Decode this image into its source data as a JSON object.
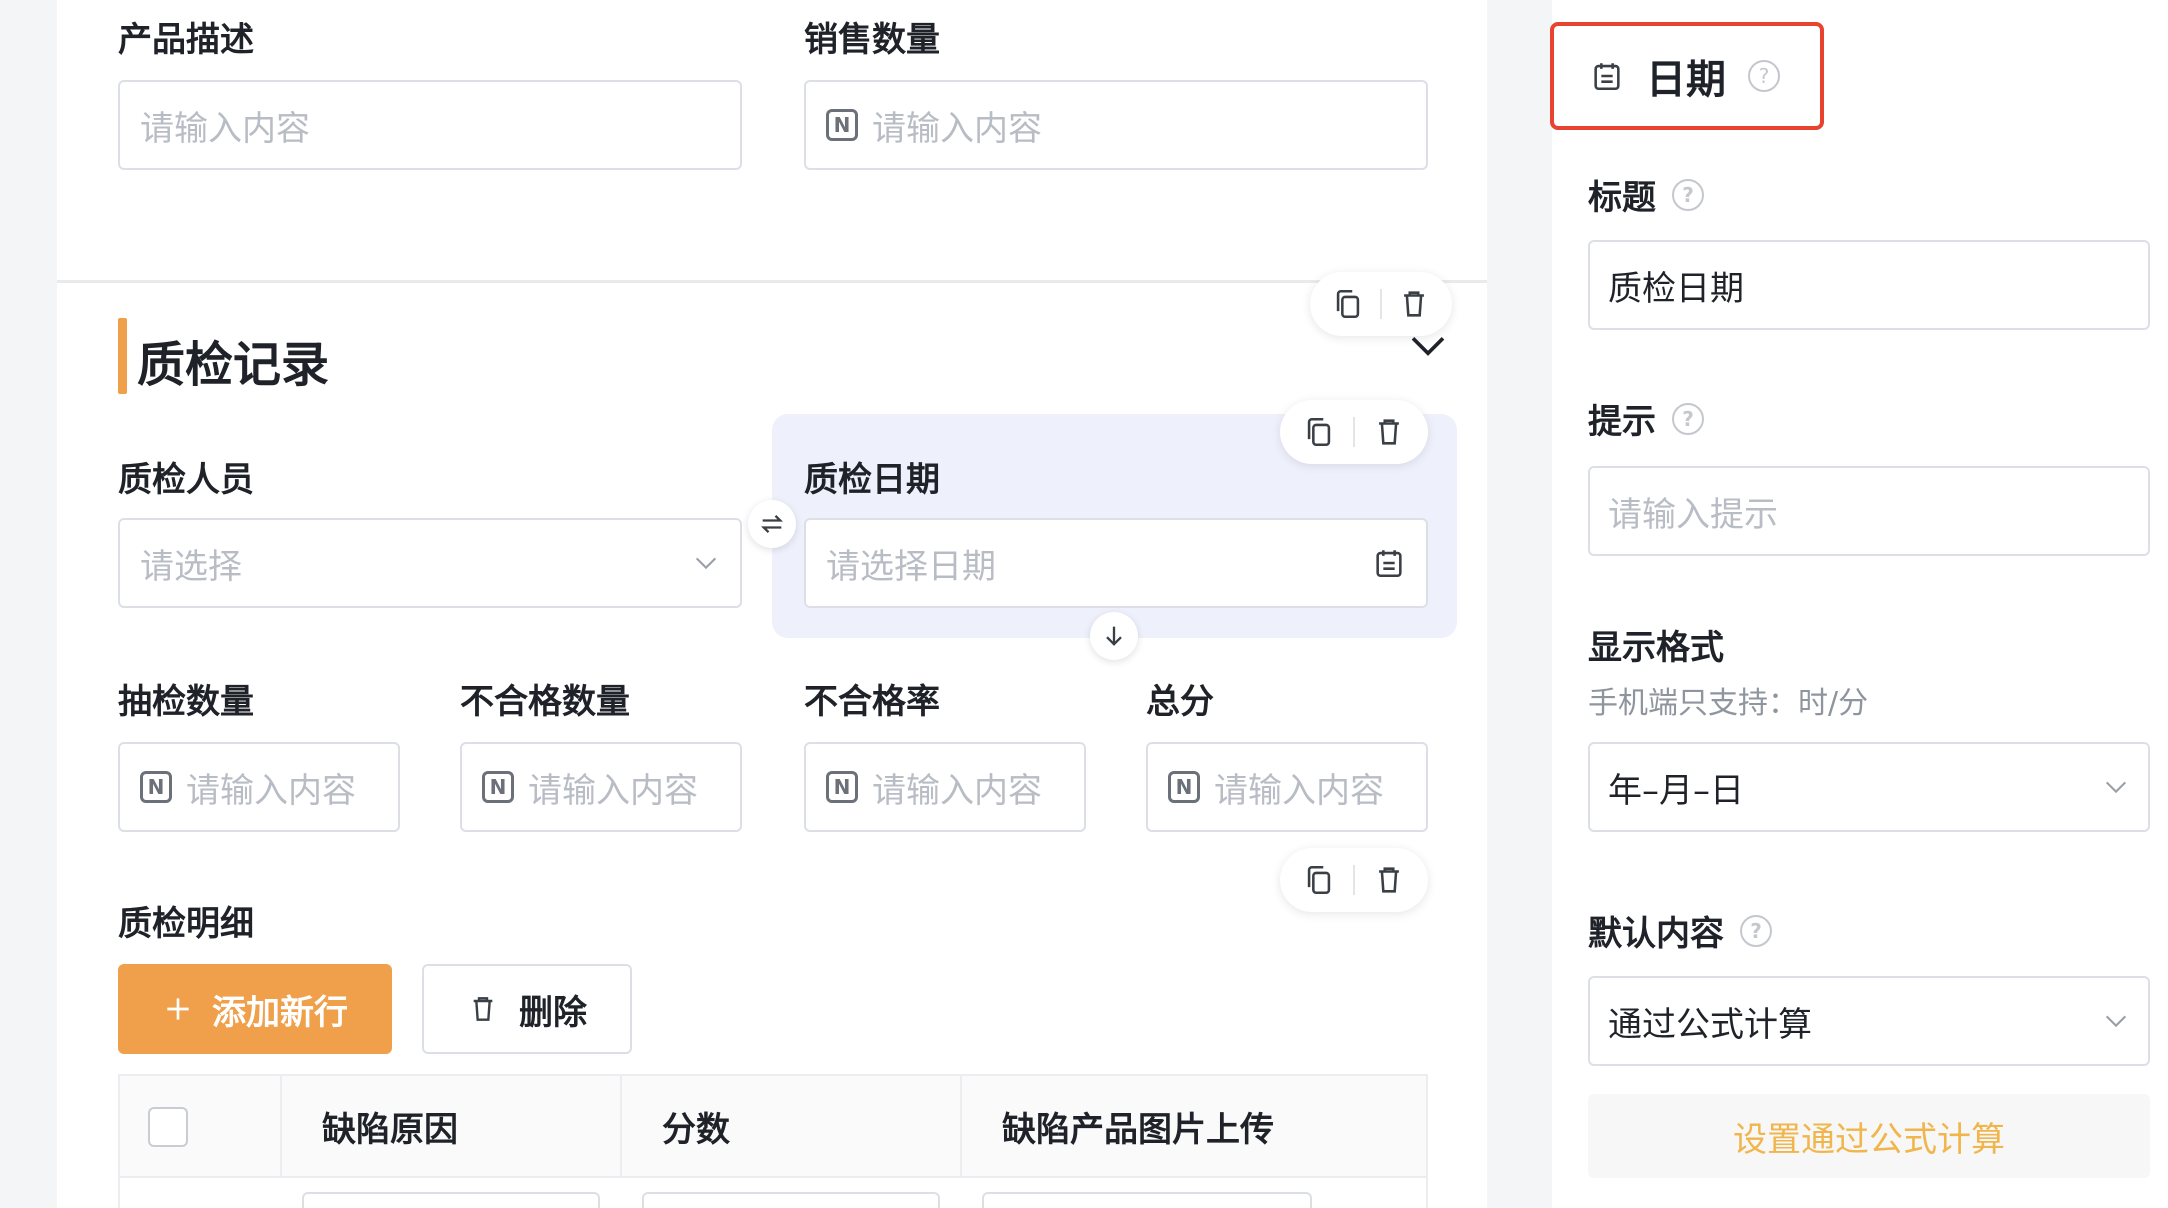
{
  "form": {
    "fields_top": {
      "product_desc": {
        "label": "产品描述",
        "placeholder": "请输入内容"
      },
      "sales_qty": {
        "label": "销售数量",
        "placeholder": "请输入内容"
      }
    },
    "section": {
      "title": "质检记录"
    },
    "inspector": {
      "label": "质检人员",
      "placeholder": "请选择"
    },
    "inspect_date": {
      "label": "质检日期",
      "placeholder": "请选择日期"
    },
    "sample_qty": {
      "label": "抽检数量",
      "placeholder": "请输入内容"
    },
    "defect_qty": {
      "label": "不合格数量",
      "placeholder": "请输入内容"
    },
    "defect_rate": {
      "label": "不合格率",
      "placeholder": "请输入内容"
    },
    "total_score": {
      "label": "总分",
      "placeholder": "请输入内容"
    },
    "detail": {
      "label": "质检明细",
      "add_button": "添加新行",
      "delete_button": "删除",
      "columns": [
        "缺陷原因",
        "分数",
        "缺陷产品图片上传"
      ]
    },
    "number_icon_glyph": "N"
  },
  "panel": {
    "type_label": "日期",
    "title_label": "标题",
    "title_value": "质检日期",
    "hint_label": "提示",
    "hint_placeholder": "请输入提示",
    "format_label": "显示格式",
    "format_sub": "手机端只支持：时/分",
    "format_value": "年–月–日",
    "default_label": "默认内容",
    "default_value": "通过公式计算",
    "formula_button": "设置通过公式计算"
  },
  "colors": {
    "accent": "#f0a04b",
    "highlight_border": "#e8432f",
    "selected_bg": "#eef1fb",
    "formula_text": "#f0b64b"
  }
}
